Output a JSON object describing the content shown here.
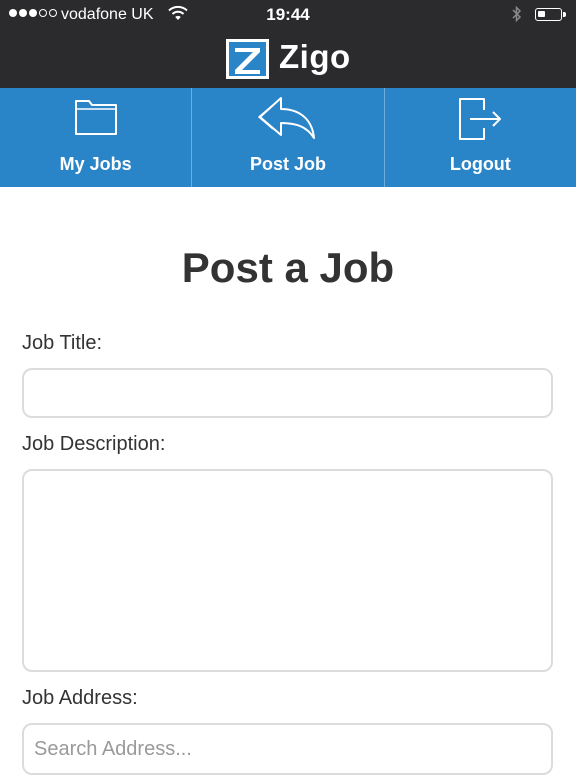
{
  "status_bar": {
    "carrier": "vodafone UK",
    "time": "19:44",
    "icons": [
      "signal-dots-icon",
      "wifi-icon",
      "bluetooth-icon",
      "battery-icon"
    ]
  },
  "header": {
    "brand": "Zigo",
    "logo_icon": "zigo-logo-icon"
  },
  "nav": {
    "items": [
      {
        "label": "My Jobs",
        "icon": "folder-icon"
      },
      {
        "label": "Post Job",
        "icon": "reply-arrow-icon"
      },
      {
        "label": "Logout",
        "icon": "logout-icon"
      }
    ]
  },
  "form": {
    "title": "Post a Job",
    "job_title_label": "Job Title:",
    "job_title_value": "",
    "job_description_label": "Job Description:",
    "job_description_value": "",
    "job_address_label": "Job Address:",
    "job_address_placeholder": "Search Address..."
  },
  "colors": {
    "header_bg": "#2b2b2d",
    "nav_bg": "#2a84c8",
    "logo_blue": "#2a84c8",
    "text": "#333333",
    "field_border": "#dcdcdc"
  }
}
